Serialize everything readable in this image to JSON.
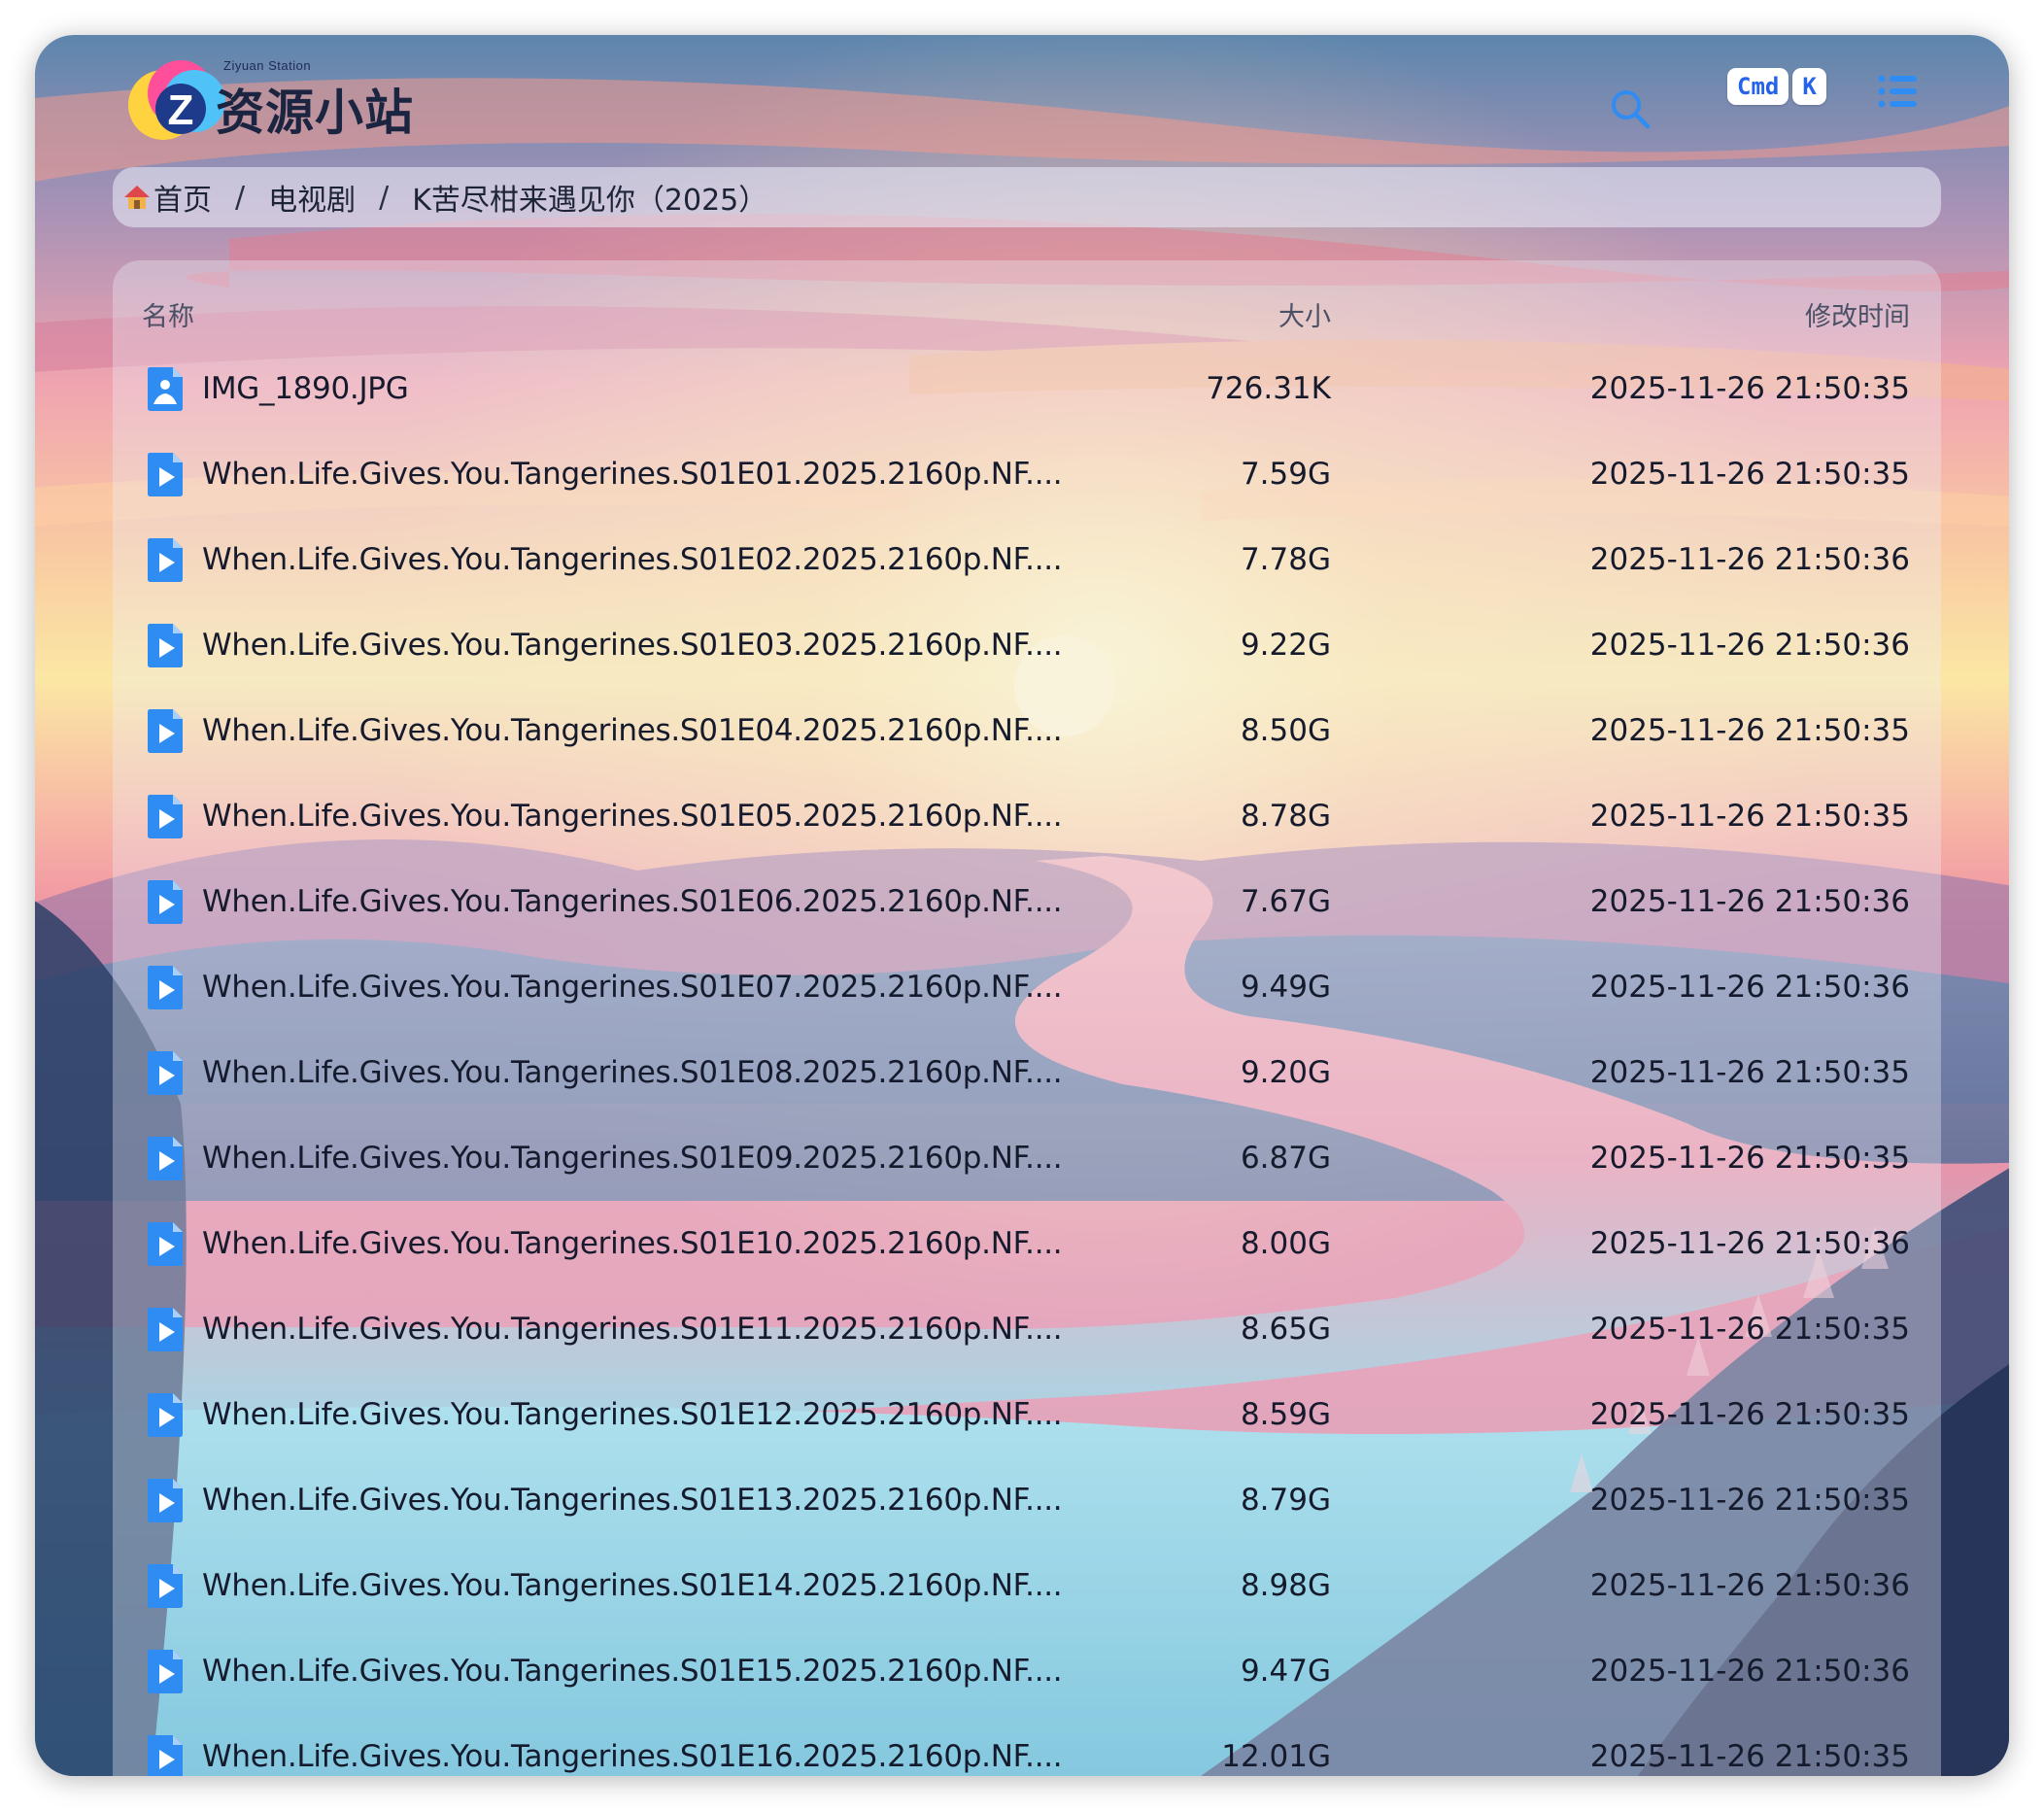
{
  "header": {
    "logo_letter": "Z",
    "logo_small_text": "Ziyuan Station",
    "logo_text": "资源小站",
    "kbd_cmd": "Cmd",
    "kbd_k": "K"
  },
  "breadcrumb": {
    "home": "首页",
    "separator": "/",
    "items": [
      "电视剧",
      "K苦尽柑来遇见你（2025）"
    ]
  },
  "table": {
    "columns": {
      "name": "名称",
      "size": "大小",
      "modified": "修改时间"
    },
    "rows": [
      {
        "icon": "image-file-icon",
        "name": "IMG_1890.JPG",
        "size": "726.31K",
        "modified": "2025-11-26 21:50:35"
      },
      {
        "icon": "video-file-icon",
        "name": "When.Life.Gives.You.Tangerines.S01E01.2025.2160p.NF....",
        "size": "7.59G",
        "modified": "2025-11-26 21:50:35"
      },
      {
        "icon": "video-file-icon",
        "name": "When.Life.Gives.You.Tangerines.S01E02.2025.2160p.NF....",
        "size": "7.78G",
        "modified": "2025-11-26 21:50:36"
      },
      {
        "icon": "video-file-icon",
        "name": "When.Life.Gives.You.Tangerines.S01E03.2025.2160p.NF....",
        "size": "9.22G",
        "modified": "2025-11-26 21:50:36"
      },
      {
        "icon": "video-file-icon",
        "name": "When.Life.Gives.You.Tangerines.S01E04.2025.2160p.NF....",
        "size": "8.50G",
        "modified": "2025-11-26 21:50:35"
      },
      {
        "icon": "video-file-icon",
        "name": "When.Life.Gives.You.Tangerines.S01E05.2025.2160p.NF....",
        "size": "8.78G",
        "modified": "2025-11-26 21:50:35"
      },
      {
        "icon": "video-file-icon",
        "name": "When.Life.Gives.You.Tangerines.S01E06.2025.2160p.NF....",
        "size": "7.67G",
        "modified": "2025-11-26 21:50:36"
      },
      {
        "icon": "video-file-icon",
        "name": "When.Life.Gives.You.Tangerines.S01E07.2025.2160p.NF....",
        "size": "9.49G",
        "modified": "2025-11-26 21:50:36"
      },
      {
        "icon": "video-file-icon",
        "name": "When.Life.Gives.You.Tangerines.S01E08.2025.2160p.NF....",
        "size": "9.20G",
        "modified": "2025-11-26 21:50:35"
      },
      {
        "icon": "video-file-icon",
        "name": "When.Life.Gives.You.Tangerines.S01E09.2025.2160p.NF....",
        "size": "6.87G",
        "modified": "2025-11-26 21:50:35"
      },
      {
        "icon": "video-file-icon",
        "name": "When.Life.Gives.You.Tangerines.S01E10.2025.2160p.NF....",
        "size": "8.00G",
        "modified": "2025-11-26 21:50:36"
      },
      {
        "icon": "video-file-icon",
        "name": "When.Life.Gives.You.Tangerines.S01E11.2025.2160p.NF....",
        "size": "8.65G",
        "modified": "2025-11-26 21:50:35"
      },
      {
        "icon": "video-file-icon",
        "name": "When.Life.Gives.You.Tangerines.S01E12.2025.2160p.NF....",
        "size": "8.59G",
        "modified": "2025-11-26 21:50:35"
      },
      {
        "icon": "video-file-icon",
        "name": "When.Life.Gives.You.Tangerines.S01E13.2025.2160p.NF....",
        "size": "8.79G",
        "modified": "2025-11-26 21:50:35"
      },
      {
        "icon": "video-file-icon",
        "name": "When.Life.Gives.You.Tangerines.S01E14.2025.2160p.NF....",
        "size": "8.98G",
        "modified": "2025-11-26 21:50:36"
      },
      {
        "icon": "video-file-icon",
        "name": "When.Life.Gives.You.Tangerines.S01E15.2025.2160p.NF....",
        "size": "9.47G",
        "modified": "2025-11-26 21:50:36"
      },
      {
        "icon": "video-file-icon",
        "name": "When.Life.Gives.You.Tangerines.S01E16.2025.2160p.NF....",
        "size": "12.01G",
        "modified": "2025-11-26 21:50:35"
      }
    ]
  },
  "colors": {
    "accent": "#2f8cf2",
    "text": "#151a2c",
    "kbd_text": "#2563eb"
  }
}
